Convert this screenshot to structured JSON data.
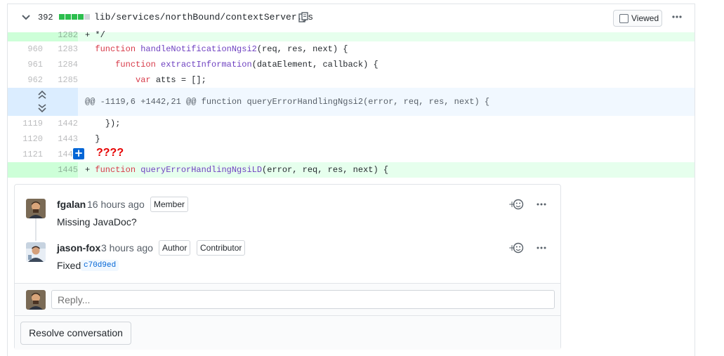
{
  "file_header": {
    "diffstat_count": "392",
    "diffstat_blocks": [
      "added",
      "added",
      "added",
      "added",
      "neutral"
    ],
    "file_path": "lib/services/northBound/contextServer.js",
    "viewed_label": "Viewed",
    "colors": {
      "added_block": "#2cbe4e",
      "neutral_block": "#d1d5da"
    }
  },
  "code_lines": {
    "r0": {
      "new": "1282",
      "sign": "+",
      "text": " */"
    },
    "r1": {
      "old": "960",
      "new": "1283",
      "kw": "function",
      "fn": "handleNotificationNgsi2",
      "rest": "(req, res, next) {"
    },
    "r2": {
      "old": "961",
      "new": "1284",
      "kw": "function",
      "fn": "extractInformation",
      "rest": "(dataElement, callback) {"
    },
    "r3": {
      "old": "962",
      "new": "1285",
      "kw": "var",
      "rest": " atts = [];"
    },
    "hunk": "@@ -1119,6 +1442,21 @@ function queryErrorHandlingNgsi2(error, req, res, next) {",
    "r4": {
      "old": "1119",
      "new": "1442",
      "text": "});"
    },
    "r5": {
      "old": "1120",
      "new": "1443",
      "text": "}"
    },
    "r6": {
      "old": "1121",
      "new": "1444",
      "annotation": "????"
    },
    "r7": {
      "new": "1445",
      "sign": "+",
      "kw": "function",
      "fn": "queryErrorHandlingNgsiLD",
      "rest": "(error, req, res, next) {"
    }
  },
  "thread": {
    "comments": [
      {
        "author": "fgalan",
        "time": "16 hours ago",
        "badges": [
          "Member"
        ],
        "body": "Missing JavaDoc?"
      },
      {
        "author": "jason-fox",
        "time": "3 hours ago",
        "badges": [
          "Author",
          "Contributor"
        ],
        "body": "Fixed",
        "sha": "c70d9ed"
      }
    ],
    "reply_placeholder": "Reply...",
    "resolve_label": "Resolve conversation",
    "reaction_label": "+"
  },
  "colors": {
    "addition_bg": "#e6ffed",
    "addition_gutter": "#cdffd8",
    "hunk_bg": "#f1f8ff",
    "keyword": "#d73a49",
    "function": "#6f42c1",
    "link": "#0366d6",
    "annotation": "#e60000"
  }
}
